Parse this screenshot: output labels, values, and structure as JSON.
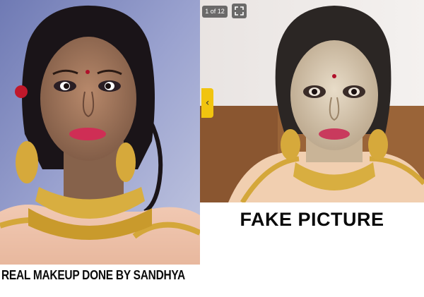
{
  "captions": {
    "left": "REAL MAKEUP DONE BY SANDHYA",
    "right": "FAKE PICTURE"
  },
  "gallery": {
    "counter": "1 of 12",
    "fullscreen_icon": "expand-icon",
    "prev_icon": "chevron-left-icon",
    "prev_glyph": "‹"
  },
  "colors": {
    "left_background": "#8b96c6",
    "right_background": "#a36a3e",
    "caption_text": "#0a0a0a",
    "arrow_accent": "#f1c40f"
  }
}
